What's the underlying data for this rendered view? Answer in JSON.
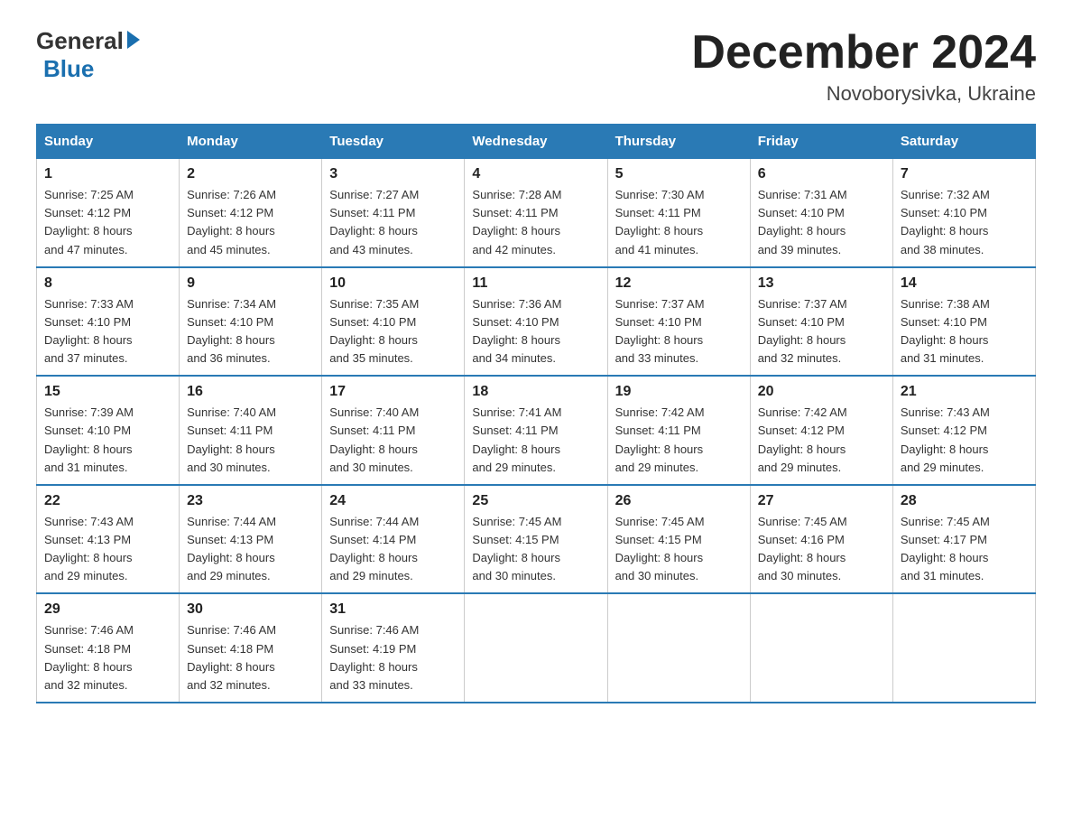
{
  "header": {
    "logo_general": "General",
    "logo_blue": "Blue",
    "month_title": "December 2024",
    "location": "Novoborysivka, Ukraine"
  },
  "weekdays": [
    "Sunday",
    "Monday",
    "Tuesday",
    "Wednesday",
    "Thursday",
    "Friday",
    "Saturday"
  ],
  "weeks": [
    [
      {
        "day": "1",
        "sunrise": "7:25 AM",
        "sunset": "4:12 PM",
        "daylight": "8 hours and 47 minutes."
      },
      {
        "day": "2",
        "sunrise": "7:26 AM",
        "sunset": "4:12 PM",
        "daylight": "8 hours and 45 minutes."
      },
      {
        "day": "3",
        "sunrise": "7:27 AM",
        "sunset": "4:11 PM",
        "daylight": "8 hours and 43 minutes."
      },
      {
        "day": "4",
        "sunrise": "7:28 AM",
        "sunset": "4:11 PM",
        "daylight": "8 hours and 42 minutes."
      },
      {
        "day": "5",
        "sunrise": "7:30 AM",
        "sunset": "4:11 PM",
        "daylight": "8 hours and 41 minutes."
      },
      {
        "day": "6",
        "sunrise": "7:31 AM",
        "sunset": "4:10 PM",
        "daylight": "8 hours and 39 minutes."
      },
      {
        "day": "7",
        "sunrise": "7:32 AM",
        "sunset": "4:10 PM",
        "daylight": "8 hours and 38 minutes."
      }
    ],
    [
      {
        "day": "8",
        "sunrise": "7:33 AM",
        "sunset": "4:10 PM",
        "daylight": "8 hours and 37 minutes."
      },
      {
        "day": "9",
        "sunrise": "7:34 AM",
        "sunset": "4:10 PM",
        "daylight": "8 hours and 36 minutes."
      },
      {
        "day": "10",
        "sunrise": "7:35 AM",
        "sunset": "4:10 PM",
        "daylight": "8 hours and 35 minutes."
      },
      {
        "day": "11",
        "sunrise": "7:36 AM",
        "sunset": "4:10 PM",
        "daylight": "8 hours and 34 minutes."
      },
      {
        "day": "12",
        "sunrise": "7:37 AM",
        "sunset": "4:10 PM",
        "daylight": "8 hours and 33 minutes."
      },
      {
        "day": "13",
        "sunrise": "7:37 AM",
        "sunset": "4:10 PM",
        "daylight": "8 hours and 32 minutes."
      },
      {
        "day": "14",
        "sunrise": "7:38 AM",
        "sunset": "4:10 PM",
        "daylight": "8 hours and 31 minutes."
      }
    ],
    [
      {
        "day": "15",
        "sunrise": "7:39 AM",
        "sunset": "4:10 PM",
        "daylight": "8 hours and 31 minutes."
      },
      {
        "day": "16",
        "sunrise": "7:40 AM",
        "sunset": "4:11 PM",
        "daylight": "8 hours and 30 minutes."
      },
      {
        "day": "17",
        "sunrise": "7:40 AM",
        "sunset": "4:11 PM",
        "daylight": "8 hours and 30 minutes."
      },
      {
        "day": "18",
        "sunrise": "7:41 AM",
        "sunset": "4:11 PM",
        "daylight": "8 hours and 29 minutes."
      },
      {
        "day": "19",
        "sunrise": "7:42 AM",
        "sunset": "4:11 PM",
        "daylight": "8 hours and 29 minutes."
      },
      {
        "day": "20",
        "sunrise": "7:42 AM",
        "sunset": "4:12 PM",
        "daylight": "8 hours and 29 minutes."
      },
      {
        "day": "21",
        "sunrise": "7:43 AM",
        "sunset": "4:12 PM",
        "daylight": "8 hours and 29 minutes."
      }
    ],
    [
      {
        "day": "22",
        "sunrise": "7:43 AM",
        "sunset": "4:13 PM",
        "daylight": "8 hours and 29 minutes."
      },
      {
        "day": "23",
        "sunrise": "7:44 AM",
        "sunset": "4:13 PM",
        "daylight": "8 hours and 29 minutes."
      },
      {
        "day": "24",
        "sunrise": "7:44 AM",
        "sunset": "4:14 PM",
        "daylight": "8 hours and 29 minutes."
      },
      {
        "day": "25",
        "sunrise": "7:45 AM",
        "sunset": "4:15 PM",
        "daylight": "8 hours and 30 minutes."
      },
      {
        "day": "26",
        "sunrise": "7:45 AM",
        "sunset": "4:15 PM",
        "daylight": "8 hours and 30 minutes."
      },
      {
        "day": "27",
        "sunrise": "7:45 AM",
        "sunset": "4:16 PM",
        "daylight": "8 hours and 30 minutes."
      },
      {
        "day": "28",
        "sunrise": "7:45 AM",
        "sunset": "4:17 PM",
        "daylight": "8 hours and 31 minutes."
      }
    ],
    [
      {
        "day": "29",
        "sunrise": "7:46 AM",
        "sunset": "4:18 PM",
        "daylight": "8 hours and 32 minutes."
      },
      {
        "day": "30",
        "sunrise": "7:46 AM",
        "sunset": "4:18 PM",
        "daylight": "8 hours and 32 minutes."
      },
      {
        "day": "31",
        "sunrise": "7:46 AM",
        "sunset": "4:19 PM",
        "daylight": "8 hours and 33 minutes."
      },
      null,
      null,
      null,
      null
    ]
  ],
  "labels": {
    "sunrise": "Sunrise:",
    "sunset": "Sunset:",
    "daylight": "Daylight:"
  }
}
